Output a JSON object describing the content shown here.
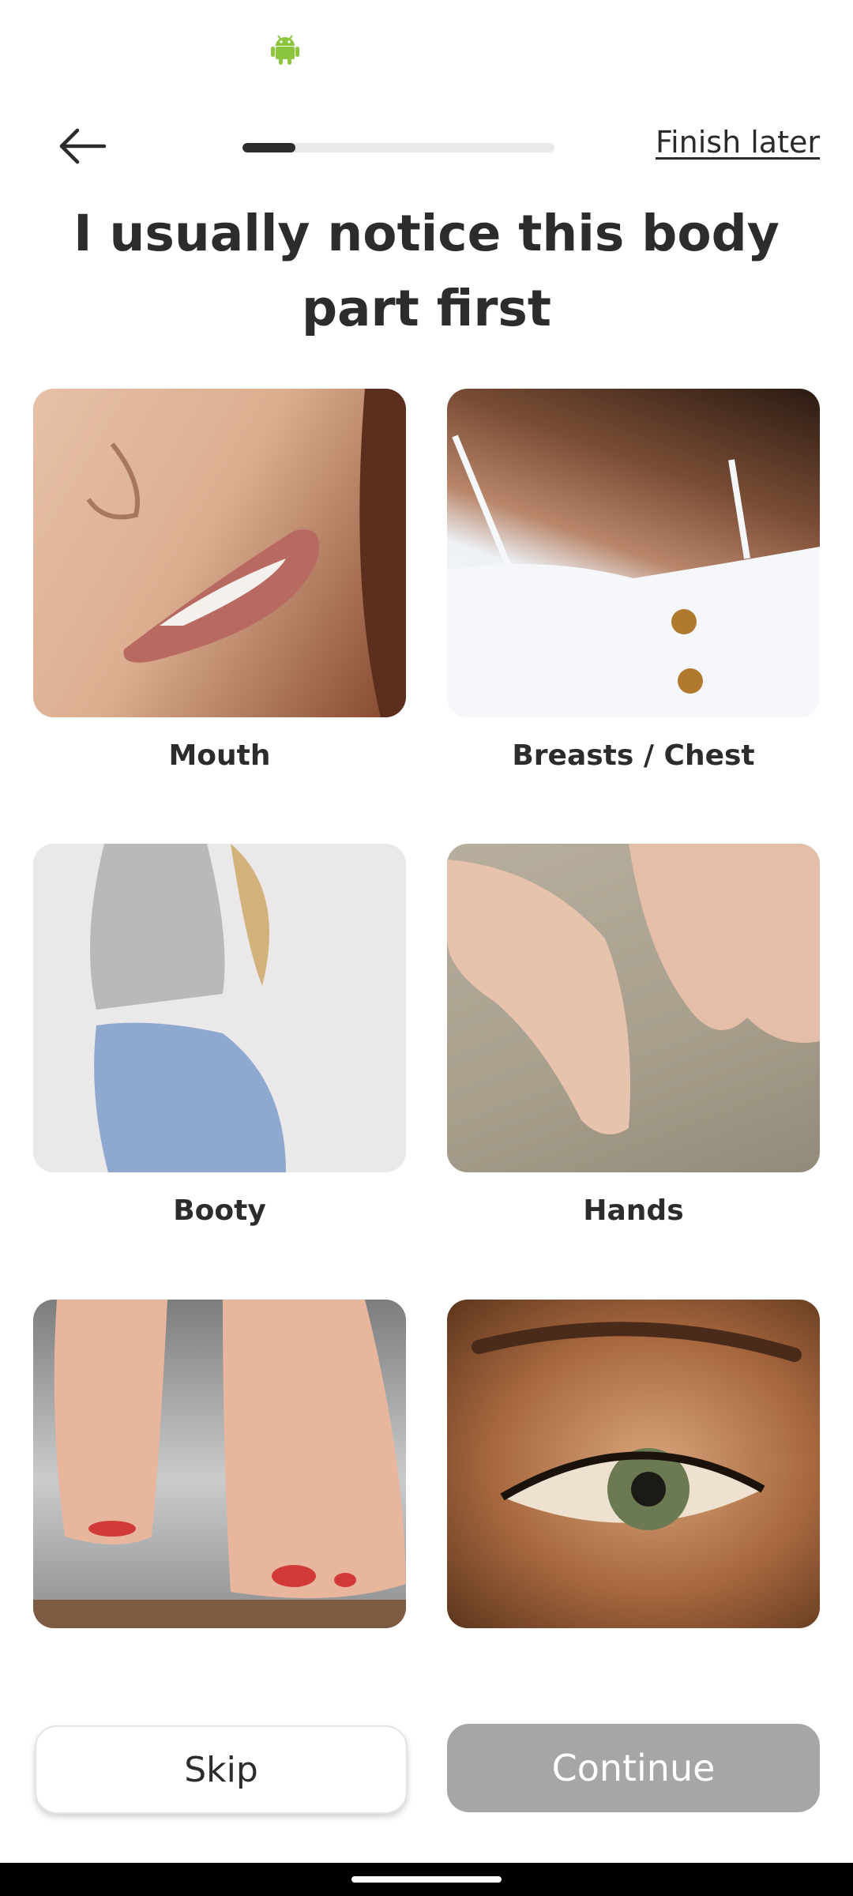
{
  "header": {
    "finish_later": "Finish later",
    "progress_fraction": 0.17
  },
  "title": "I usually notice this body part first",
  "options": [
    {
      "label": "Mouth"
    },
    {
      "label": "Breasts / Chest"
    },
    {
      "label": "Booty"
    },
    {
      "label": "Hands"
    },
    {
      "label": ""
    },
    {
      "label": ""
    }
  ],
  "actions": {
    "skip": "Skip",
    "continue": "Continue"
  },
  "colors": {
    "android_icon": "#8cc63f",
    "progress_fill": "#2c2c2c",
    "continue_disabled": "#a6a6a6"
  },
  "icons": {
    "status": "android-icon",
    "back": "arrow-left-icon"
  }
}
